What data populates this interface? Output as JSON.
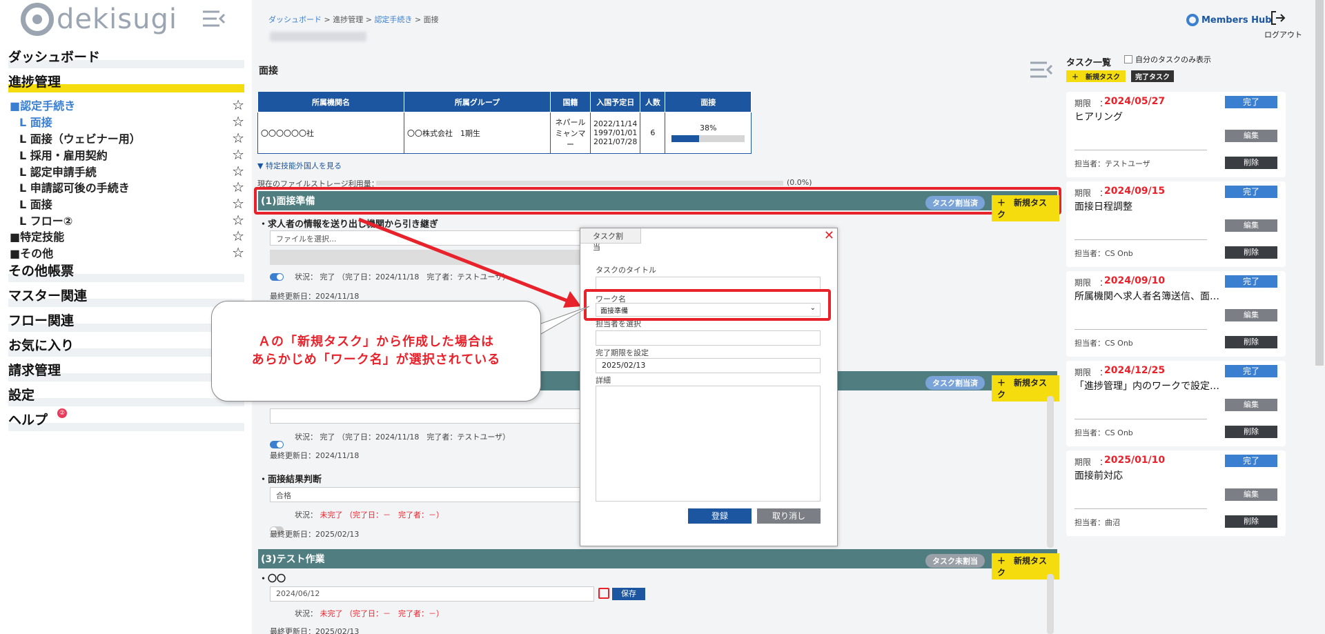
{
  "brand": {
    "logo_text": "dekisugi",
    "members_hub": "Members Hub",
    "logout": "ログアウト"
  },
  "sidebar": {
    "main": [
      {
        "label": "ダッシュボード"
      },
      {
        "label": "進捗管理"
      },
      {
        "label": "その他帳票"
      },
      {
        "label": "マスター関連"
      },
      {
        "label": "フロー関連"
      },
      {
        "label": "お気に入り"
      },
      {
        "label": "請求管理"
      },
      {
        "label": "設定"
      },
      {
        "label": "ヘルプ"
      }
    ],
    "help_badge": "②",
    "sub": [
      {
        "label": "■認定手続き"
      },
      {
        "label": "L 面接"
      },
      {
        "label": "L 面接（ウェビナー用）"
      },
      {
        "label": "L 採用・雇用契約"
      },
      {
        "label": "L 認定申請手続"
      },
      {
        "label": "L 申請認可後の手続き"
      },
      {
        "label": "L 面接"
      },
      {
        "label": "L フロー②"
      },
      {
        "label": "■特定技能"
      },
      {
        "label": "■その他"
      }
    ],
    "star": "☆"
  },
  "breadcrumb": {
    "b1": "ダッシュボード",
    "b2": "進捗管理",
    "b3": "認定手続き",
    "b4": "面接",
    "sep": ">"
  },
  "page_title": "面接",
  "table": {
    "headers": [
      "所属機関名",
      "所属グループ",
      "国籍",
      "入国予定日",
      "人数",
      "面接"
    ],
    "row": {
      "org": "〇〇〇〇〇〇社",
      "group": "〇〇株式会社　1期生",
      "nationality": "ネパール ミャンマー",
      "dates": "2022/11/14 1997/01/01 2021/07/28",
      "count": "6",
      "progress": "38%"
    },
    "progress_value": 0.38
  },
  "foreign_link": "▼ 特定技能外国人を見る",
  "storage": {
    "label": "現在のファイルストレージ利用量：",
    "value": "(0.0%)"
  },
  "sections": [
    {
      "title": "(1)面接準備",
      "assign": "タスク割当済",
      "new": "＋　新規タスク"
    },
    {
      "assign": "タスク割当済",
      "new": "＋　新規タスク"
    },
    {
      "title": "(3)テスト作業",
      "assign": "タスク未割当",
      "new": "＋　新規タスク"
    }
  ],
  "work1": {
    "title": "・求人者の情報を送り出し機関から引き継ぎ",
    "file_placeholder": "ファイルを選択...",
    "status_label": "状況：",
    "status": "完了",
    "detail": "（完了日：2024/11/18　完了者：テストユーザ）",
    "updated": "最終更新日：2024/11/18"
  },
  "work2": {
    "status_label": "状況：",
    "status": "完了",
    "detail": "（完了日：2024/11/18　完了者：テストユーザ）",
    "updated": "最終更新日：2024/11/18"
  },
  "work3": {
    "title": "・面接結果判断",
    "value": "合格",
    "status_label": "状況：",
    "status": "未完了",
    "detail": "（完了日：－　完了者：－）",
    "updated": "最終更新日：2025/02/13"
  },
  "work4": {
    "title": "・〇〇",
    "date": "2024/06/12",
    "save": "保存",
    "status_label": "状況：",
    "status": "未完了",
    "detail": "（完了日：－　完了者：－）",
    "updated": "最終更新日：2025/02/13"
  },
  "modal": {
    "tab": "タスク割当",
    "close": "✕",
    "title_label": "タスクのタイトル",
    "title_value": "",
    "work_label": "ワーク名",
    "work_value": "面接準備",
    "assignee_label": "担当者を選択",
    "deadline_label": "完了期限を設定",
    "deadline_value": "2025/02/13",
    "detail_label": "詳細",
    "submit": "登録",
    "cancel": "取り消し"
  },
  "callout": {
    "line1": "Ａの「新規タスク」から作成した場合は",
    "line2": "あらかじめ「ワーク名」が選択されている"
  },
  "tasks": {
    "title": "タスク一覧",
    "only_mine": "自分のタスクのみ表示",
    "new_tab": "＋　新規タスク",
    "done_tab": "完了タスク",
    "deadline_label": "期限　：",
    "done_btn": "完了",
    "edit_btn": "編集",
    "delete_btn": "削除",
    "items": [
      {
        "date": "2024/05/27",
        "title": "ヒアリング",
        "assignee": "担当者：テストユーザ"
      },
      {
        "date": "2024/09/15",
        "title": "面接日程調整",
        "assignee": "担当者：CS Onb"
      },
      {
        "date": "2024/09/10",
        "title": "所属機関へ求人者名簿送信、面…",
        "assignee": "担当者：CS Onb"
      },
      {
        "date": "2024/12/25",
        "title": "「進捗管理」内のワークで設定…",
        "assignee": "担当者：CS Onb"
      },
      {
        "date": "2025/01/10",
        "title": "面接前対応",
        "assignee": "担当者：曲沼"
      }
    ]
  },
  "colors": {
    "accent_blue": "#1c56a0",
    "link_blue": "#3b7fd0",
    "section_teal": "#4f7d80",
    "highlight_yellow": "#f5dc0f",
    "alert_red": "#e8222b"
  }
}
